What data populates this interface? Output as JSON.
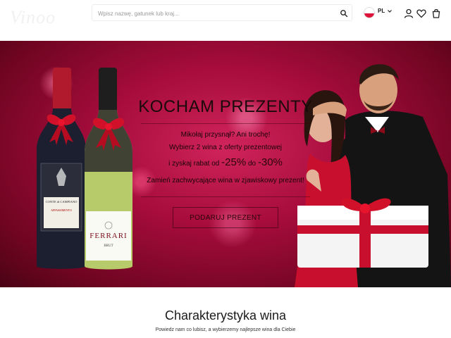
{
  "header": {
    "logo_text": "Vinoo",
    "search": {
      "placeholder": "Wpisz nazwę, gatunek lub kraj...",
      "value": ""
    },
    "language": {
      "code": "PL"
    },
    "icons": [
      "account-icon",
      "heart-icon",
      "cart-icon"
    ]
  },
  "hero": {
    "title": "KOCHAM PREZENTY",
    "line1": "Mikołaj przysnął? Ani trochę!",
    "line2": "Wybierz 2 wina z oferty prezentowej",
    "line3_prefix": "i zyskaj rabat od",
    "line3_from": "-25%",
    "line3_mid": "do",
    "line3_to": "-30%",
    "line4": "Zamień zachwycające wina w zjawiskowy prezent!",
    "cta": "PODARUJ PREZENT",
    "bottle_labels": {
      "left": "CONTE di CAMPIANO",
      "left_sub": "APPASSIMENTO",
      "right": "FERRARI",
      "right_sub": "BRUT"
    }
  },
  "section": {
    "title": "Charakterystyka wina",
    "subtitle": "Powiedz nam co lubisz, a wybierzemy najlepsze wina dla Ciebie"
  },
  "colors": {
    "hero_red": "#a60c3c",
    "ribbon": "#c8102e",
    "accent_dark": "#1a0508"
  }
}
